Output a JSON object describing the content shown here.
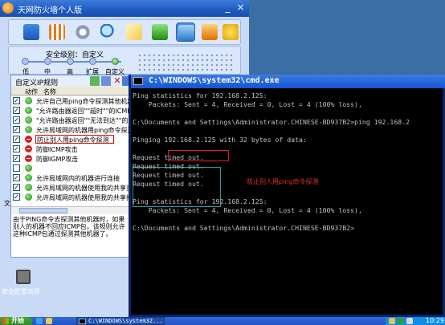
{
  "firewall": {
    "title": "天网防火墙个人版",
    "minimize": "_",
    "close": "×",
    "security_level_label": "安全级别：自定义",
    "levels": [
      "低",
      "中",
      "高",
      "扩展",
      "自定义"
    ],
    "current_level": "自定义",
    "rules_panel_title": "自定义IP规则",
    "columns": {
      "action": "动作",
      "name": "名称"
    },
    "rules": [
      {
        "checked": true,
        "action": "allow",
        "name": "允许自己用ping命令探测其他机器"
      },
      {
        "checked": true,
        "action": "allow",
        "name": "\"允许路由器返回\"\"超时\"\"的ICMP回应包"
      },
      {
        "checked": true,
        "action": "allow",
        "name": "\"允许路由器返回\"\"无法到达\"\"的ICMP回应包"
      },
      {
        "checked": true,
        "action": "allow",
        "name": "允许局域网的机器用ping命令探测"
      },
      {
        "checked": true,
        "action": "deny",
        "name": "防止别人用ping命令探测"
      },
      {
        "checked": true,
        "action": "deny",
        "name": "防御ICMP攻击"
      },
      {
        "checked": true,
        "action": "deny",
        "name": "防御IGMP攻击"
      },
      {
        "checked": false,
        "action": "allow",
        "name": ""
      },
      {
        "checked": true,
        "action": "allow",
        "name": "允许局域网内的机器进行连接"
      },
      {
        "checked": true,
        "action": "allow",
        "name": "允许局域网的机器使用我的共享资源"
      },
      {
        "checked": true,
        "action": "allow",
        "name": "允许局域网的机器使用我的共享打印机"
      }
    ],
    "description": "由于PING命令去探测其他机器时，如果别人的机器不回应ICMP包，该规则允许这种ICMP包通过探测其他机器了。",
    "side_label": "文",
    "assistant_label": "安全配置向导"
  },
  "cmd": {
    "title": "C:\\WINDOWS\\system32\\cmd.exe",
    "lines": [
      "Ping statistics for 192.168.2.125:",
      "    Packets: Sent = 4, Received = 0, Lost = 4 (100% loss),",
      "",
      "C:\\Documents and Settings\\Administrator.CHINESE-BD937B2>ping 192.168.2",
      "",
      "Pinging 192.168.2.125 with 32 bytes of data:",
      "",
      "Request timed out.",
      "Request timed out.",
      "Request timed out.",
      "Request timed out.",
      "",
      "Ping statistics for 192.168.2.125:",
      "    Packets: Sent = 4, Received = 0, Lost = 4 (100% loss),",
      "",
      "C:\\Documents and Settings\\Administrator.CHINESE-BD937B2>"
    ],
    "annotation": "防止别人用ping命令探测"
  },
  "taskbar": {
    "start": "开始",
    "task_button": "C:\\WINDOWS\\system32...",
    "clock": "10:29"
  }
}
